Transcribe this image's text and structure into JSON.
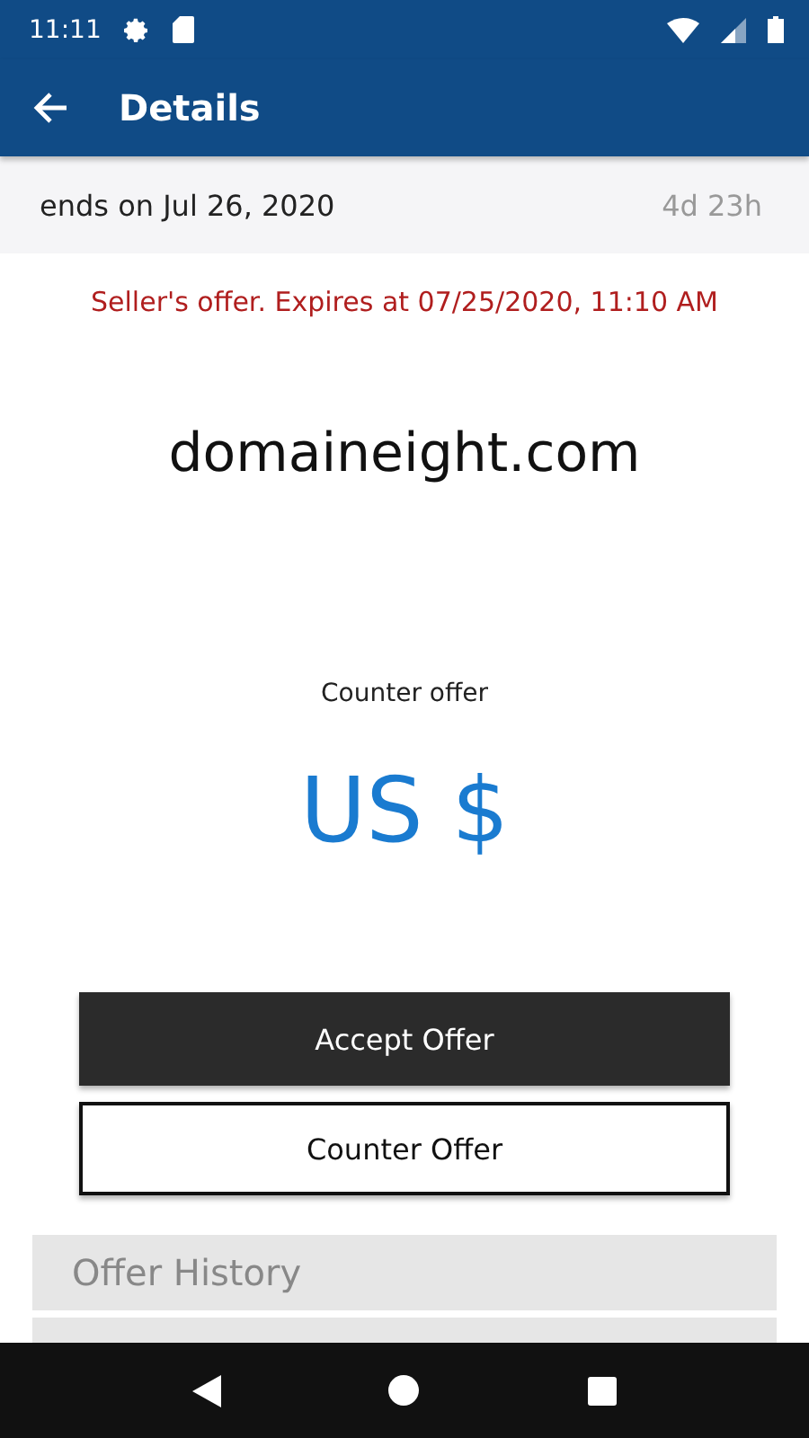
{
  "status_bar": {
    "time": "11:11"
  },
  "app_bar": {
    "title": "Details"
  },
  "auction": {
    "ends": "ends on Jul 26, 2020",
    "remaining": "4d 23h"
  },
  "offer_notice": "Seller's offer. Expires at 07/25/2020, 11:10 AM",
  "domain": "domaineight.com",
  "counter": {
    "label": "Counter offer",
    "amount": "US $"
  },
  "buttons": [
    {
      "label": "Accept Offer",
      "kind": "primary"
    },
    {
      "label": "Counter Offer",
      "kind": "secondary"
    }
  ],
  "sections": [
    {
      "title": "Offer History"
    }
  ]
}
